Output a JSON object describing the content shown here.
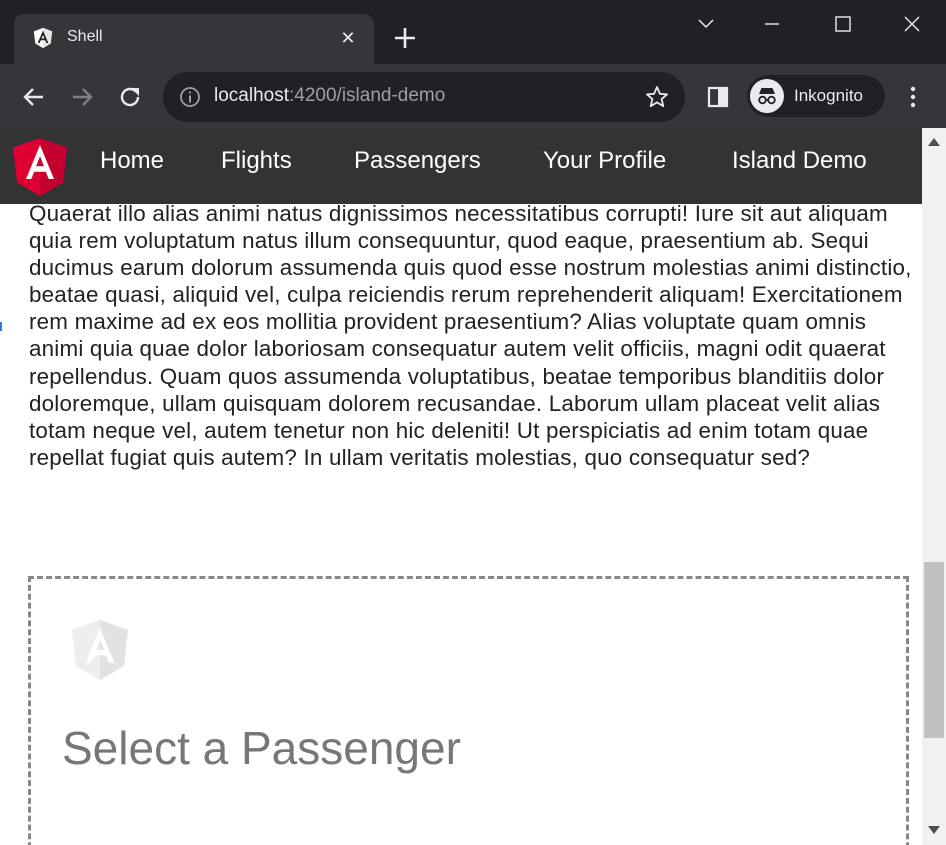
{
  "browser": {
    "tab": {
      "title": "Shell",
      "close_glyph": "✕"
    },
    "address": {
      "host": "localhost",
      "rest": ":4200/island-demo"
    },
    "profile": {
      "label": "Inkognito"
    }
  },
  "app": {
    "nav": {
      "logo_letter": "A",
      "items": [
        "Home",
        "Flights",
        "Passengers",
        "Your Profile",
        "Island Demo"
      ]
    },
    "body_text": "Quaerat illo alias animi natus dignissimos necessitatibus corrupti! Iure sit aut aliquam quia rem voluptatum natus illum consequuntur, quod eaque, praesentium ab. Sequi ducimus earum dolorum assumenda quis quod esse nostrum molestias animi distinctio, beatae quasi, aliquid vel, culpa reiciendis rerum reprehenderit aliquam! Exercitationem rem maxime ad ex eos mollitia provident praesentium? Alias voluptate quam omnis animi quia quae dolor laboriosam consequatur autem velit officiis, magni odit quaerat repellendus. Quam quos assumenda voluptatibus, beatae temporibus blanditiis dolor doloremque, ullam quisquam dolorem recusandae. Laborum ullam placeat velit alias totam neque vel, autem tenetur non hic deleniti! Ut perspiciatis ad enim totam quae repellat fugiat quis autem? In ullam veritatis molestias, quo consequatur sed?",
    "island": {
      "logo_letter": "A",
      "heading": "Select a Passenger"
    }
  },
  "colors": {
    "angular_red": "#dd0031",
    "nav_bg": "#333333",
    "chrome_dark": "#202124",
    "chrome_toolbar": "#35363a"
  }
}
